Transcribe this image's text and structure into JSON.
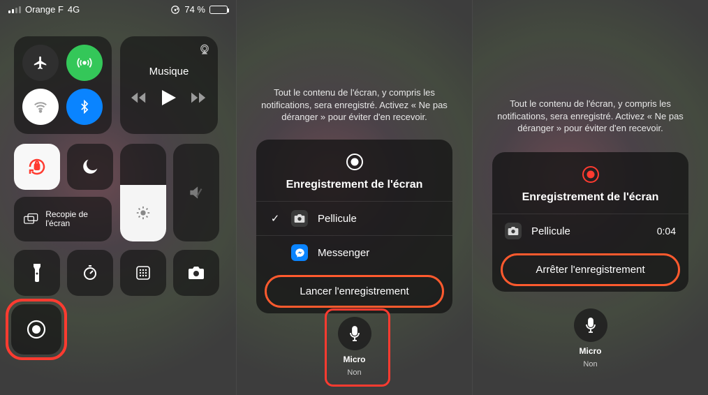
{
  "statusbar": {
    "carrier": "Orange F",
    "network": "4G",
    "battery_pct": "74 %"
  },
  "controlCenter": {
    "music_label": "Musique",
    "mirror_label": "Recopie de l'écran"
  },
  "panel2": {
    "info": "Tout le contenu de l'écran, y compris les notifications, sera enregistré. Activez « Ne pas déranger » pour éviter d'en recevoir.",
    "modal_title": "Enregistrement de l'écran",
    "item1": "Pellicule",
    "item2": "Messenger",
    "action": "Lancer l'enregistrement",
    "mic_label": "Micro",
    "mic_state": "Non"
  },
  "panel3": {
    "info": "Tout le contenu de l'écran, y compris les notifications, sera enregistré. Activez « Ne pas déranger » pour éviter d'en recevoir.",
    "modal_title": "Enregistrement de l'écran",
    "item1": "Pellicule",
    "timer": "0:04",
    "action": "Arrêter l'enregistrement",
    "mic_label": "Micro",
    "mic_state": "Non"
  }
}
